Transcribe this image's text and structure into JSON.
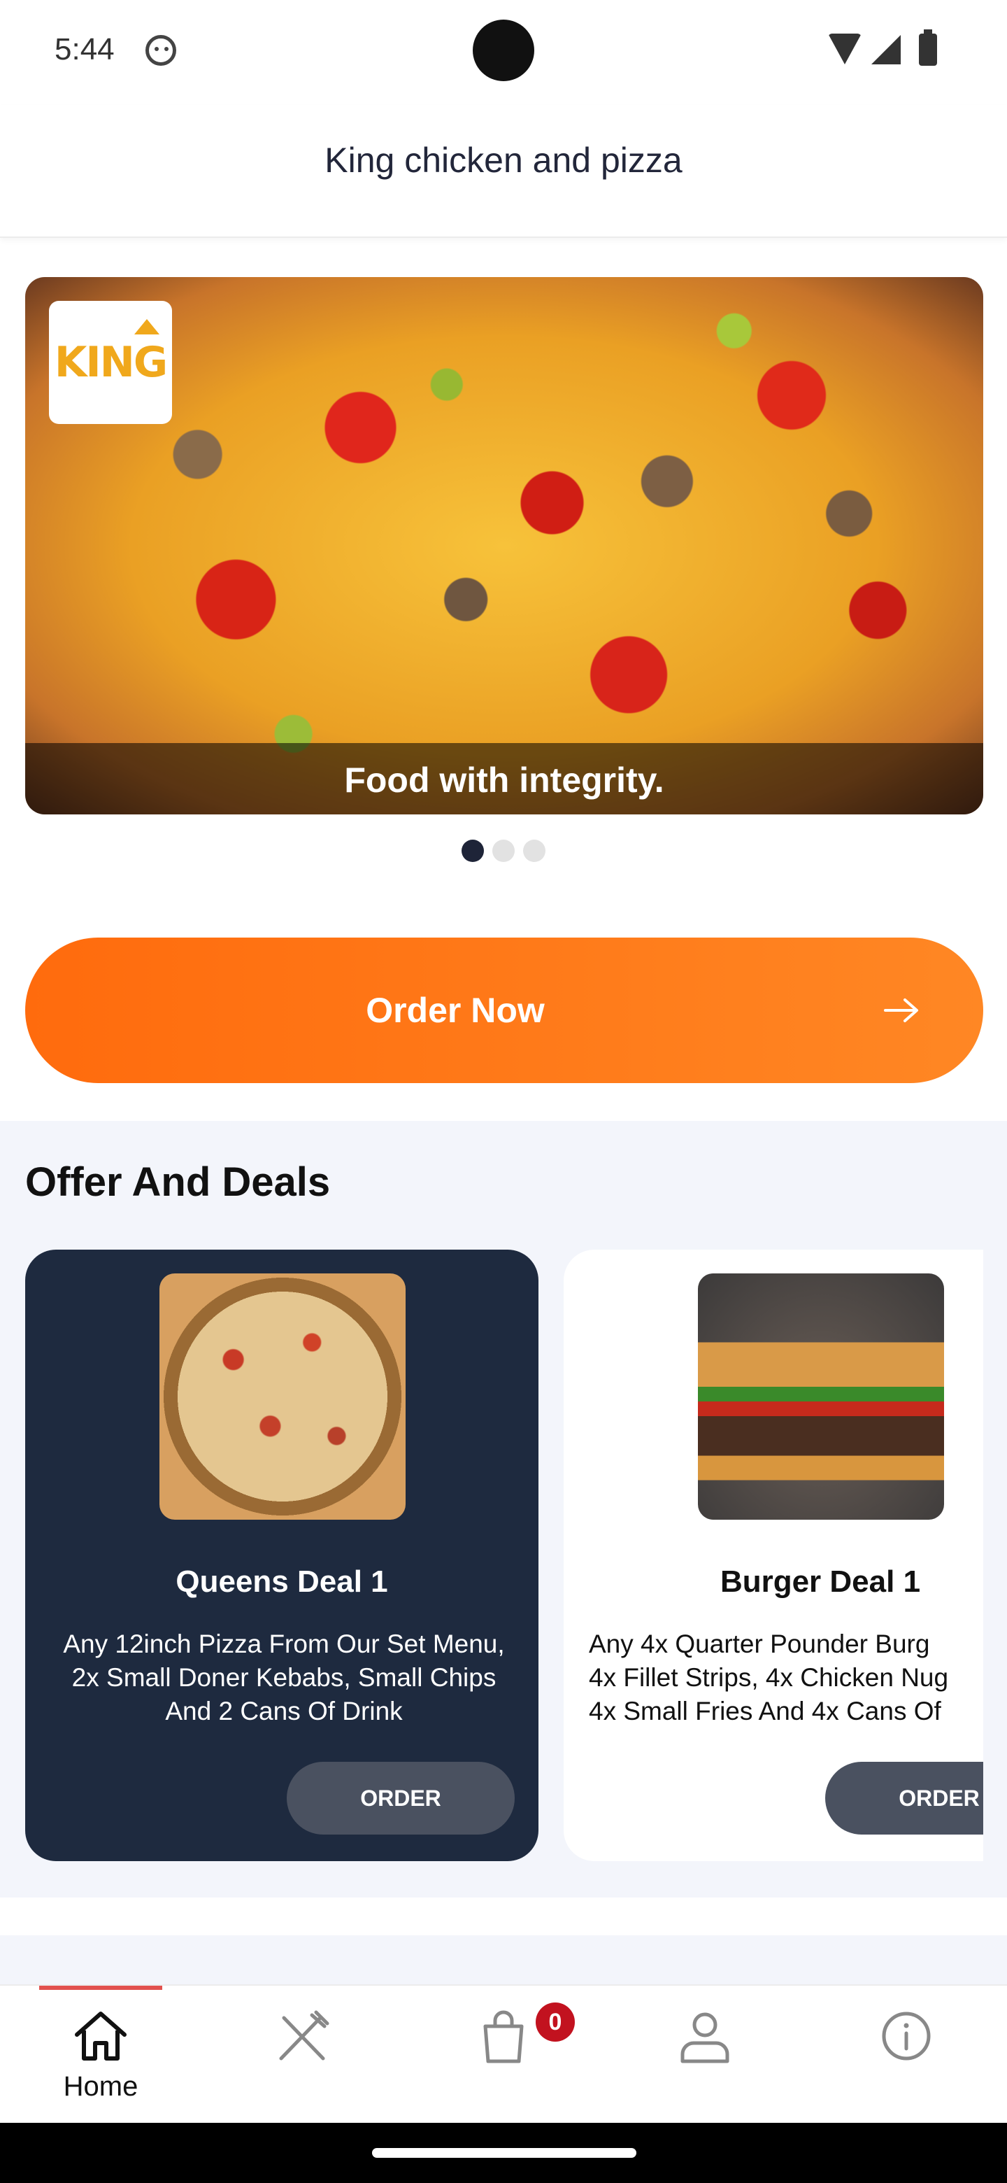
{
  "status_bar": {
    "time": "5:44"
  },
  "header": {
    "title": "King chicken and pizza"
  },
  "banner": {
    "logo_text": "KING",
    "caption": "Food with integrity.",
    "dots_total": 3,
    "active_dot": 0
  },
  "order_now": {
    "label": "Order Now"
  },
  "offers": {
    "title": "Offer And Deals",
    "deals": [
      {
        "name": "Queens Deal 1",
        "description": "Any 12inch Pizza From Our Set Menu, 2x Small Doner Kebabs, Small Chips And 2 Cans Of Drink",
        "button": "ORDER"
      },
      {
        "name": "Burger Deal 1",
        "description_lines": [
          "Any 4x Quarter Pounder Burg",
          "4x Fillet Strips, 4x Chicken Nug",
          "4x Small Fries And 4x Cans Of"
        ],
        "button": "ORDER"
      }
    ]
  },
  "bottom_nav": {
    "items": [
      {
        "label": "Home",
        "icon": "home-icon",
        "active": true
      },
      {
        "label": "",
        "icon": "fork-knife-icon",
        "active": false
      },
      {
        "label": "",
        "icon": "shopping-bag-icon",
        "active": false,
        "badge": "0"
      },
      {
        "label": "",
        "icon": "user-icon",
        "active": false
      },
      {
        "label": "",
        "icon": "info-icon",
        "active": false
      }
    ]
  },
  "colors": {
    "accent_orange": "#ff7a1a",
    "dark_navy": "#1e2a3f",
    "nav_indicator": "#e2514e",
    "badge_red": "#c2121f"
  }
}
